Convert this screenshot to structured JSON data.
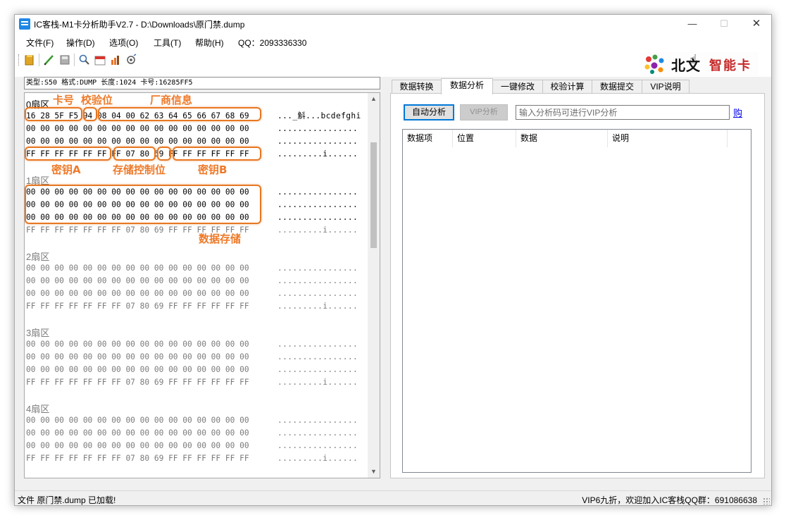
{
  "window": {
    "title": "IC客栈-M1卡分析助手V2.7 - D:\\Downloads\\原门禁.dump",
    "min_glyph": "—",
    "max_glyph": "☐",
    "close_glyph": "✕"
  },
  "menu": {
    "items": [
      "文件(F)",
      "操作(D)",
      "选项(O)",
      "工具(T)",
      "帮助(H)",
      "QQ：2093336330"
    ]
  },
  "toolbar": {
    "icons": [
      "open-folder-icon",
      "edit-pen-icon",
      "save-disk-icon",
      "search-icon",
      "calendar-icon",
      "chart-icon",
      "settings-wizard-icon"
    ]
  },
  "logo": {
    "text_black": "北文",
    "text_red": "智能卡"
  },
  "info_bar": "类型:S50 格式:DUMP 长度:1024 卡号:16285FF5",
  "hex_view": {
    "sectors": [
      {
        "label": "0扇区",
        "rows": [
          {
            "hex": "16 28 5F F5 94 08 04 00 62 63 64 65 66 67 68 69",
            "ascii": "..._斛...bcdefghi"
          },
          {
            "hex": "00 00 00 00 00 00 00 00 00 00 00 00 00 00 00 00",
            "ascii": "................"
          },
          {
            "hex": "00 00 00 00 00 00 00 00 00 00 00 00 00 00 00 00",
            "ascii": "................"
          },
          {
            "hex": "FF FF FF FF FF FF FF 07 80 69 FF FF FF FF FF FF",
            "ascii": ".........i......"
          }
        ]
      },
      {
        "label": "1扇区",
        "rows": [
          {
            "hex": "00 00 00 00 00 00 00 00 00 00 00 00 00 00 00 00",
            "ascii": "................"
          },
          {
            "hex": "00 00 00 00 00 00 00 00 00 00 00 00 00 00 00 00",
            "ascii": "................"
          },
          {
            "hex": "00 00 00 00 00 00 00 00 00 00 00 00 00 00 00 00",
            "ascii": "................"
          },
          {
            "hex": "FF FF FF FF FF FF FF 07 80 69 FF FF FF FF FF FF",
            "ascii": ".........i......"
          }
        ]
      },
      {
        "label": "2扇区",
        "rows": [
          {
            "hex": "00 00 00 00 00 00 00 00 00 00 00 00 00 00 00 00",
            "ascii": "................"
          },
          {
            "hex": "00 00 00 00 00 00 00 00 00 00 00 00 00 00 00 00",
            "ascii": "................"
          },
          {
            "hex": "00 00 00 00 00 00 00 00 00 00 00 00 00 00 00 00",
            "ascii": "................"
          },
          {
            "hex": "FF FF FF FF FF FF FF 07 80 69 FF FF FF FF FF FF",
            "ascii": ".........i......"
          }
        ]
      },
      {
        "label": "3扇区",
        "rows": [
          {
            "hex": "00 00 00 00 00 00 00 00 00 00 00 00 00 00 00 00",
            "ascii": "................"
          },
          {
            "hex": "00 00 00 00 00 00 00 00 00 00 00 00 00 00 00 00",
            "ascii": "................"
          },
          {
            "hex": "00 00 00 00 00 00 00 00 00 00 00 00 00 00 00 00",
            "ascii": "................"
          },
          {
            "hex": "FF FF FF FF FF FF FF 07 80 69 FF FF FF FF FF FF",
            "ascii": ".........i......"
          }
        ]
      },
      {
        "label": "4扇区",
        "rows": [
          {
            "hex": "00 00 00 00 00 00 00 00 00 00 00 00 00 00 00 00",
            "ascii": "................"
          },
          {
            "hex": "00 00 00 00 00 00 00 00 00 00 00 00 00 00 00 00",
            "ascii": "................"
          },
          {
            "hex": "00 00 00 00 00 00 00 00 00 00 00 00 00 00 00 00",
            "ascii": "................"
          },
          {
            "hex": "FF FF FF FF FF FF FF 07 80 69 FF FF FF FF FF FF",
            "ascii": ".........i......"
          }
        ]
      }
    ],
    "scroll_up": "▲",
    "scroll_down": "▼"
  },
  "annotations": {
    "card_number": "卡号",
    "checksum": "校验位",
    "manufacturer": "厂商信息",
    "key_a": "密钥A",
    "access_bits": "存储控制位",
    "key_b": "密钥B",
    "data_storage": "数据存储",
    "color": "#ee7a2a"
  },
  "tabs": [
    "数据转换",
    "数据分析",
    "一键修改",
    "校验计算",
    "数据提交",
    "VIP说明"
  ],
  "active_tab": "数据分析",
  "analysis": {
    "auto_button": "自动分析",
    "vip_button": "VIP分析",
    "input_placeholder": "输入分析码可进行VIP分析",
    "input_value": "",
    "buy_link": "购"
  },
  "list": {
    "columns": [
      "数据项",
      "位置",
      "数据",
      "说明"
    ]
  },
  "status": {
    "left": "文件 原门禁.dump 已加载!",
    "right": "VIP6九折，欢迎加入IC客栈QQ群：691086638"
  },
  "colors": {
    "accent_blue": "#0078d7",
    "highlight_orange": "#e87722",
    "logo_red": "#c62828"
  }
}
